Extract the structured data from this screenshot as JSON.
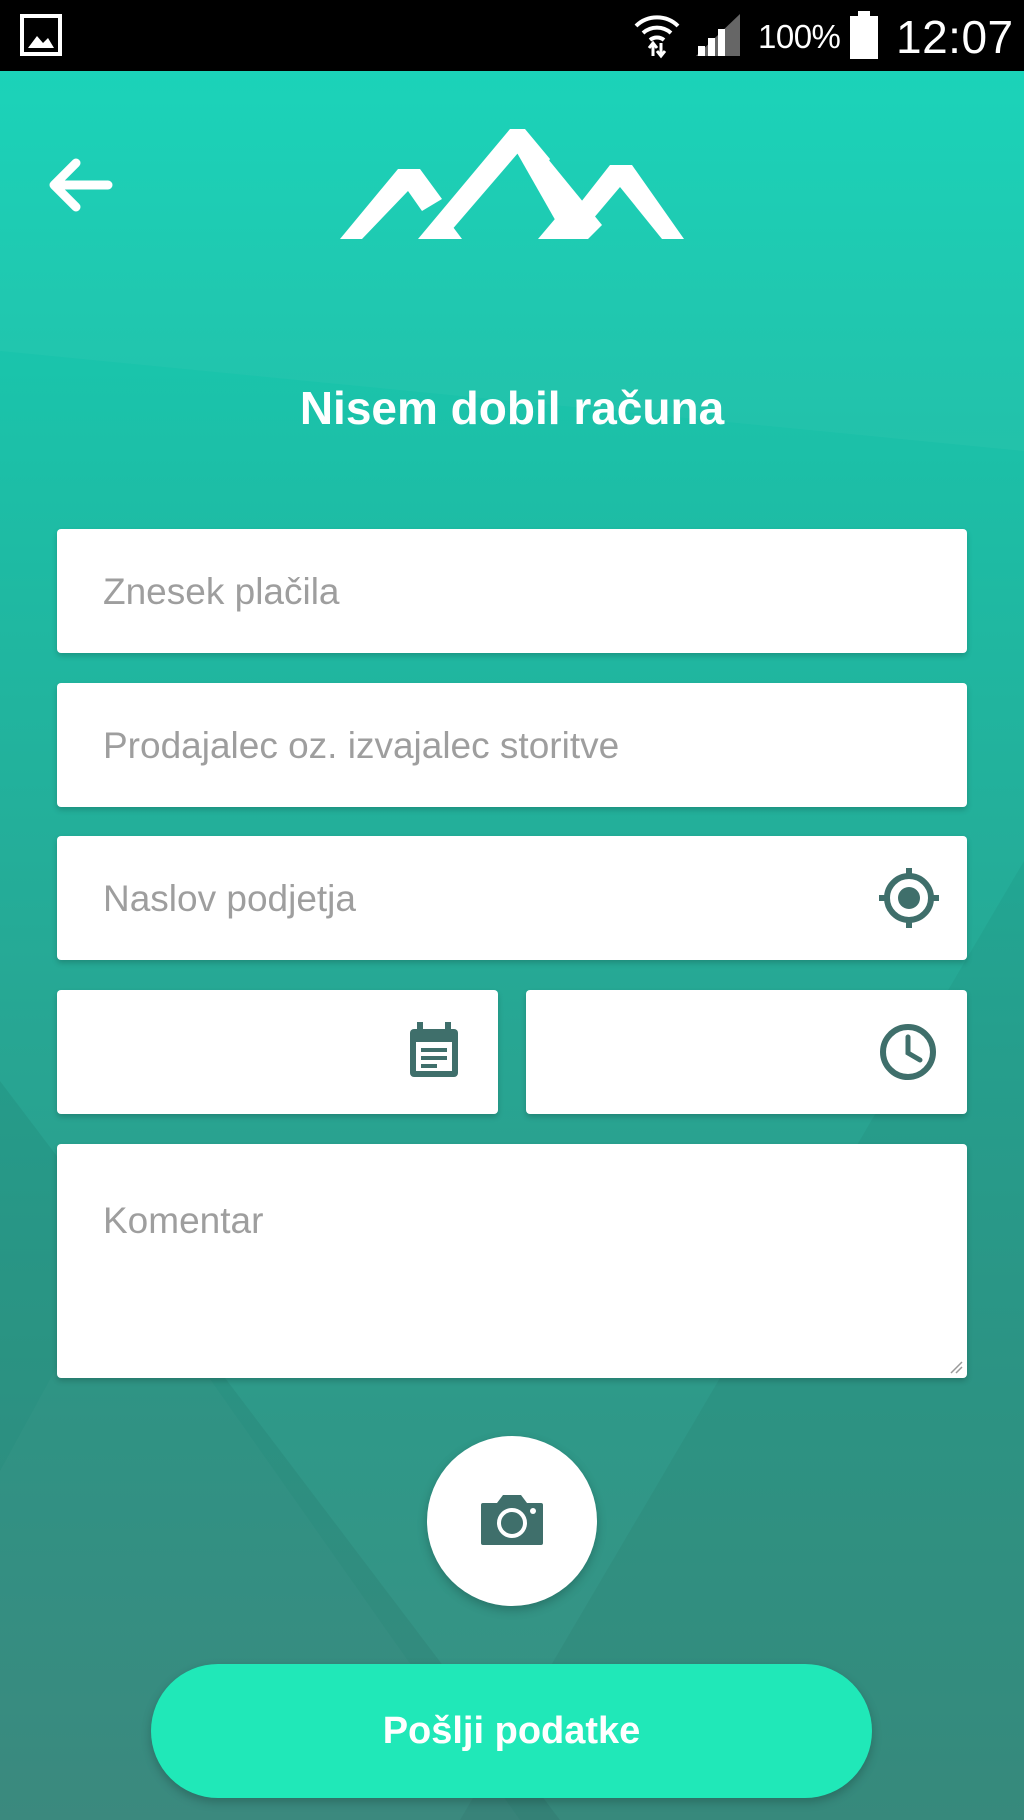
{
  "status_bar": {
    "battery_percent": "100%",
    "time": "12:07",
    "icons": [
      "gallery-icon",
      "wifi-icon",
      "signal-icon",
      "battery-icon"
    ]
  },
  "header": {
    "back_icon": "arrow-left-icon",
    "logo": "mountains-logo"
  },
  "page": {
    "title": "Nisem dobil računa"
  },
  "form": {
    "amount": {
      "placeholder": "Znesek plačila"
    },
    "seller": {
      "placeholder": "Prodajalec oz. izvajalec storitve"
    },
    "address": {
      "placeholder": "Naslov podjetja",
      "icon": "location-target-icon"
    },
    "date": {
      "icon": "calendar-icon"
    },
    "time": {
      "icon": "clock-icon"
    },
    "comment": {
      "placeholder": "Komentar"
    }
  },
  "actions": {
    "camera_icon": "camera-icon",
    "submit_label": "Pošlji podatke"
  },
  "colors": {
    "gradient_top": "#14d2b7",
    "gradient_bottom": "#3a8f82",
    "accent_button": "#20e8b8",
    "icon_color": "#3f6f6b",
    "placeholder": "#9e9e9e"
  }
}
